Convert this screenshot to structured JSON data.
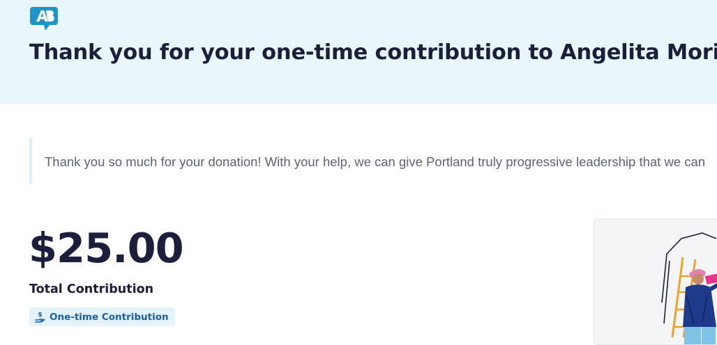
{
  "header": {
    "logo_icon": "ab-speech-bubble-logo",
    "title": "Thank you for your one-time contribution to Angelita Morillo"
  },
  "message": {
    "text": "Thank you so much for your donation! With your help, we can give Portland truly progressive leadership that we can"
  },
  "contribution": {
    "amount": "$25.00",
    "total_label": "Total Contribution",
    "badge_icon": "hand-dollar-icon",
    "badge_label": "One-time Contribution"
  },
  "illustration": {
    "icon": "person-on-ladder-illustration"
  },
  "colors": {
    "header_bg": "#e9f6fb",
    "brand_blue": "#1c96c6",
    "heading": "#1b1f3b",
    "badge_text": "#1a5fa6"
  }
}
